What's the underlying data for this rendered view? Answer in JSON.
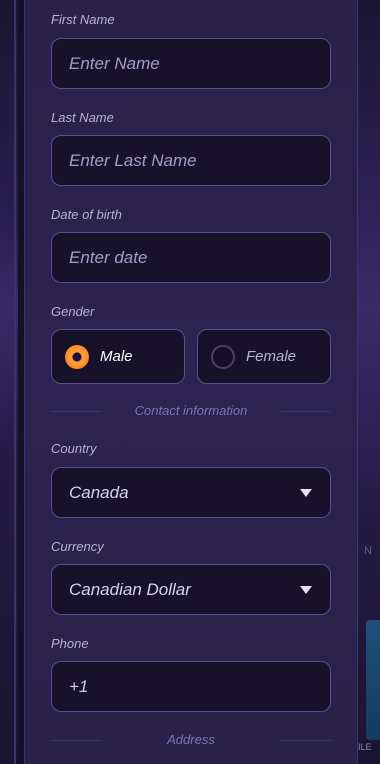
{
  "form": {
    "first_name": {
      "label": "First Name",
      "placeholder": "Enter Name"
    },
    "last_name": {
      "label": "Last Name",
      "placeholder": "Enter Last Name"
    },
    "dob": {
      "label": "Date of birth",
      "placeholder": "Enter date"
    },
    "gender": {
      "label": "Gender",
      "options": [
        {
          "label": "Male",
          "selected": true
        },
        {
          "label": "Female",
          "selected": false
        }
      ]
    },
    "contact_section": "Contact information",
    "country": {
      "label": "Country",
      "value": "Canada"
    },
    "currency": {
      "label": "Currency",
      "value": "Canadian Dollar"
    },
    "phone": {
      "label": "Phone",
      "value": "+1"
    },
    "address_section": "Address"
  },
  "background": {
    "right_tag": "N",
    "right_badge_text": "ILE"
  },
  "colors": {
    "accent": "#ff8a25",
    "panel": "#2a2148",
    "field_bg": "#17122a",
    "field_border": "#5a4e92"
  }
}
